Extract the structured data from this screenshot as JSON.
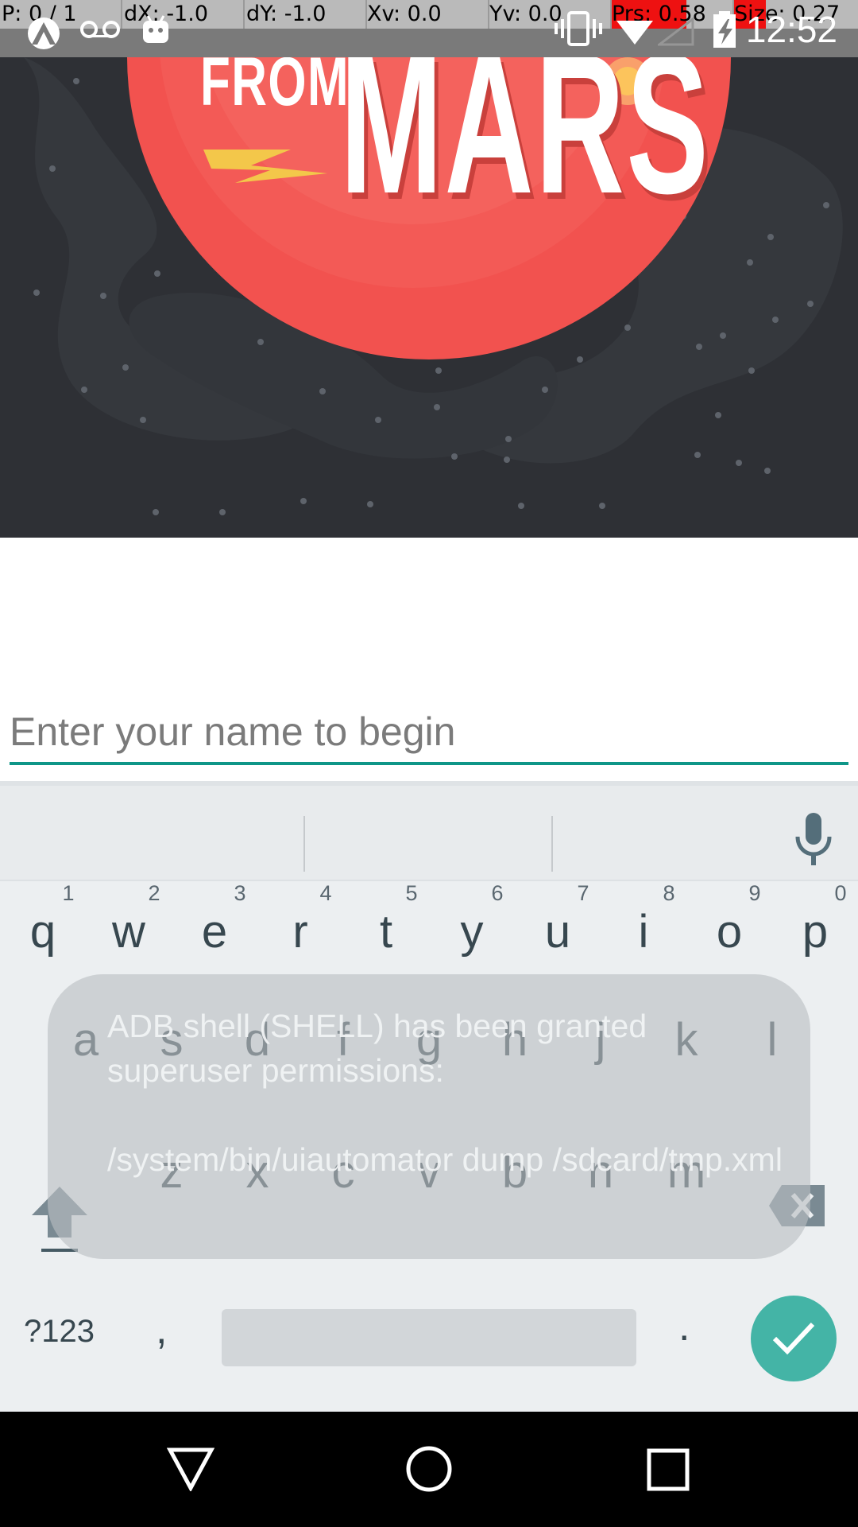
{
  "pointer_overlay": {
    "p": "P: 0 / 1",
    "dx": "dX: -1.0",
    "dy": "dY: -1.0",
    "xv": "Xv: 0.0",
    "yv": "Yv: 0.0",
    "prs": "Prs: 0.58",
    "size": "Size: 0.27",
    "highlight_color": "#ee1111"
  },
  "status_bar": {
    "time": "12:52",
    "left_icons": [
      "app-notification-icon",
      "voicemail-icon",
      "android-debug-icon"
    ],
    "right_icons": [
      "vibrate-icon",
      "wifi-icon",
      "no-signal-icon",
      "battery-charging-icon"
    ]
  },
  "hero": {
    "title_small": "FROM",
    "title_large": "MARS",
    "background_color": "#2e3035",
    "planet_color": "#f2524f"
  },
  "name_input": {
    "value": "",
    "placeholder": "Enter your name to begin",
    "underline_color": "#0f9688"
  },
  "keyboard": {
    "suggestions": [
      "",
      "",
      ""
    ],
    "mic_icon": "microphone-icon",
    "row1": [
      {
        "ch": "q",
        "hint": "1"
      },
      {
        "ch": "w",
        "hint": "2"
      },
      {
        "ch": "e",
        "hint": "3"
      },
      {
        "ch": "r",
        "hint": "4"
      },
      {
        "ch": "t",
        "hint": "5"
      },
      {
        "ch": "y",
        "hint": "6"
      },
      {
        "ch": "u",
        "hint": "7"
      },
      {
        "ch": "i",
        "hint": "8"
      },
      {
        "ch": "o",
        "hint": "9"
      },
      {
        "ch": "p",
        "hint": "0"
      }
    ],
    "row2": [
      "a",
      "s",
      "d",
      "f",
      "g",
      "h",
      "j",
      "k",
      "l"
    ],
    "row3": [
      "z",
      "x",
      "c",
      "v",
      "b",
      "n",
      "m"
    ],
    "symbols_label": "?123",
    "comma_label": ",",
    "period_label": ".",
    "enter_color": "#44b4a6"
  },
  "toast": {
    "message": "ADB shell (SHELL) has been granted superuser permissions:\n\n/system/bin/uiautomator dump /sdcard/tmp.xml"
  },
  "nav_bar": {
    "buttons": [
      "back-icon",
      "home-icon",
      "recents-icon"
    ]
  }
}
